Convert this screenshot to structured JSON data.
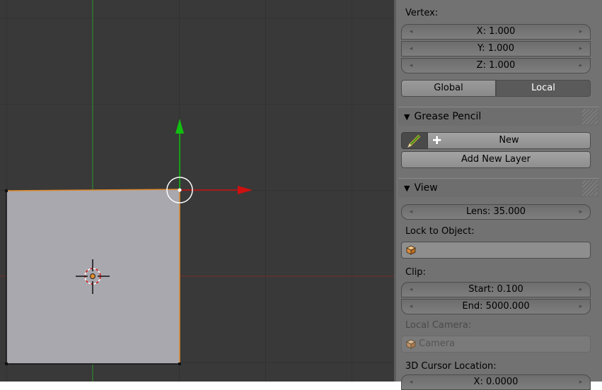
{
  "panel": {
    "vertex_label": "Vertex:",
    "vertex_x": "X: 1.000",
    "vertex_y": "Y: 1.000",
    "vertex_z": "Z: 1.000",
    "global_label": "Global",
    "local_label": "Local",
    "grease_pencil_title": "Grease Pencil",
    "new_label": "New",
    "add_layer_label": "Add New Layer",
    "view_title": "View",
    "lens_value": "Lens: 35.000",
    "lock_label": "Lock to Object:",
    "lock_value": "",
    "clip_label": "Clip:",
    "clip_start": "Start: 0.100",
    "clip_end": "End: 5000.000",
    "local_camera_label": "Local Camera:",
    "camera_value": "Camera",
    "cursor_location_label": "3D Cursor Location:",
    "cursor_x": "X: 0.0000"
  },
  "icons": {
    "left_arrow": "◂",
    "right_arrow": "▸",
    "collapse": "▼",
    "plus": "✚"
  },
  "colors": {
    "viewport_bg": "#393939",
    "panel_bg": "#727272",
    "x_axis": "#d01010",
    "y_axis": "#10c010",
    "selection_orange": "#e08a2c",
    "mesh_face": "#a8a8ae"
  },
  "toggles": {
    "local_active": true
  }
}
